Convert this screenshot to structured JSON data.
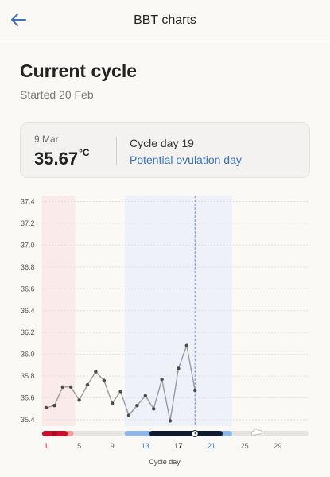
{
  "header": {
    "title": "BBT charts"
  },
  "current_cycle": {
    "title": "Current cycle",
    "started": "Started 20 Feb"
  },
  "summary": {
    "date": "9 Mar",
    "temp": "35.67",
    "unit": "°C",
    "cycle_day": "Cycle day 19",
    "ovulation_link": "Potential ovulation day"
  },
  "colors": {
    "period": "#c8102e",
    "fertile": "#8fb4e8",
    "ovulation": "#101a2e",
    "line": "#9a9a9a",
    "point": "#4a4a4a",
    "link": "#3a73b8"
  },
  "chart_data": {
    "type": "line",
    "xlabel": "Cycle day",
    "ylim": [
      35.35,
      37.45
    ],
    "y_ticks": [
      "37.4",
      "37.2",
      "37.0",
      "36.8",
      "36.6",
      "36.4",
      "36.2",
      "36.0",
      "35.8",
      "35.6",
      "35.4"
    ],
    "x_ticks": [
      "1",
      "5",
      "9",
      "13",
      "17",
      "21",
      "25",
      "29"
    ],
    "x_range": [
      1,
      31
    ],
    "period_days": [
      1,
      4
    ],
    "fertile_window": [
      11,
      23
    ],
    "ovulation_day": 19,
    "values": [
      35.51,
      35.53,
      35.7,
      35.7,
      35.58,
      35.72,
      35.84,
      35.76,
      35.55,
      35.66,
      35.44,
      35.53,
      35.62,
      35.5,
      35.77,
      35.39,
      35.87,
      36.08,
      35.67
    ],
    "grid": true
  }
}
